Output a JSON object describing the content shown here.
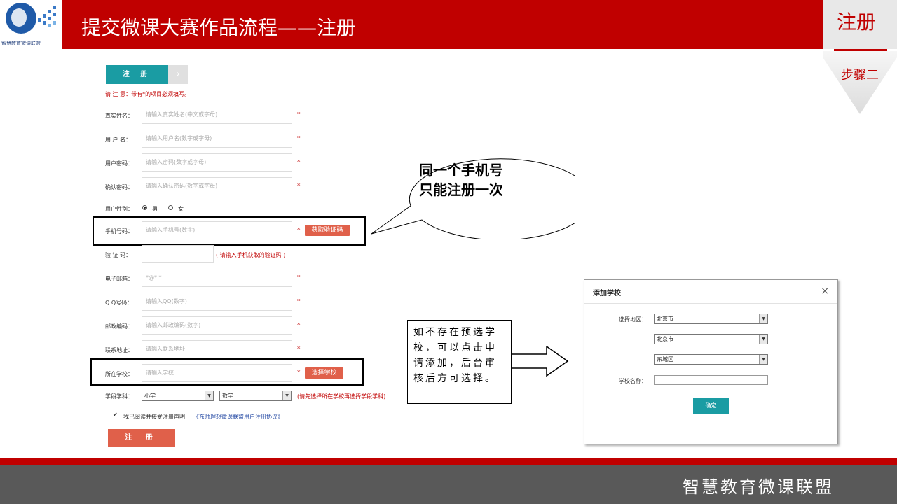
{
  "header": {
    "title": "提交微课大赛作品流程——注册",
    "logo_text": "智慧教育微课联盟"
  },
  "step": {
    "title": "注册",
    "subtitle": "步骤二"
  },
  "form": {
    "tab_label": "注 册",
    "tab_arrow": "›",
    "notice": "请 注 意：带有*的项目必须填写。",
    "required_mark": "*",
    "fields": {
      "real_name": {
        "label": "真实姓名：",
        "placeholder": "请输入真实姓名(中文或字母)"
      },
      "username": {
        "label": "用 户 名：",
        "placeholder": "请输入用户名(数字或字母)"
      },
      "password": {
        "label": "用户密码：",
        "placeholder": "请输入密码(数字或字母)"
      },
      "confirm_password": {
        "label": "确认密码：",
        "placeholder": "请输入确认密码(数字或字母)"
      },
      "gender": {
        "label": "用户性别：",
        "male": "男",
        "female": "女"
      },
      "phone": {
        "label": "手机号码：",
        "placeholder": "请输入手机号(数字)",
        "button": "获取验证码"
      },
      "code": {
        "label": "验 证 码：",
        "hint": "( 请输入手机获取的验证码 )"
      },
      "email": {
        "label": "电子邮箱：",
        "placeholder": "*@*.*"
      },
      "qq": {
        "label": "Q Q号码：",
        "placeholder": "请输入QQ(数字)"
      },
      "postcode": {
        "label": "邮政编码：",
        "placeholder": "请输入邮政编码(数字)"
      },
      "address": {
        "label": "联系地址：",
        "placeholder": "请输入联系地址"
      },
      "school": {
        "label": "所在学校：",
        "placeholder": "请输入学校",
        "button": "选择学校"
      },
      "subject": {
        "label": "学段学科：",
        "stage": "小学",
        "subject": "数学",
        "hint": "(请先选择所在学校再选择学段学科)"
      }
    },
    "agreement": {
      "check": "✔",
      "text": "我已阅读并接受注册声明",
      "link": "《东师理想微课联盟用户注册协议》"
    },
    "submit": "注 册"
  },
  "bubble": {
    "line1": "同一个手机号",
    "line2": "只能注册一次"
  },
  "callout": {
    "line1": "如不存在预选学",
    "line2": "校，可以点击申",
    "line3": "请添加，后台审",
    "line4": "核后方可选择。"
  },
  "dialog": {
    "title": "添加学校",
    "close": "×",
    "region_label": "选择地区：",
    "province": "北京市",
    "city": "北京市",
    "district": "东城区",
    "school_name_label": "学校名称：",
    "ok": "确定"
  },
  "footer": {
    "text": "智慧教育微课联盟"
  },
  "colors": {
    "brand_red": "#c00000",
    "teal": "#1a9ca3",
    "button_red": "#e0604a"
  }
}
